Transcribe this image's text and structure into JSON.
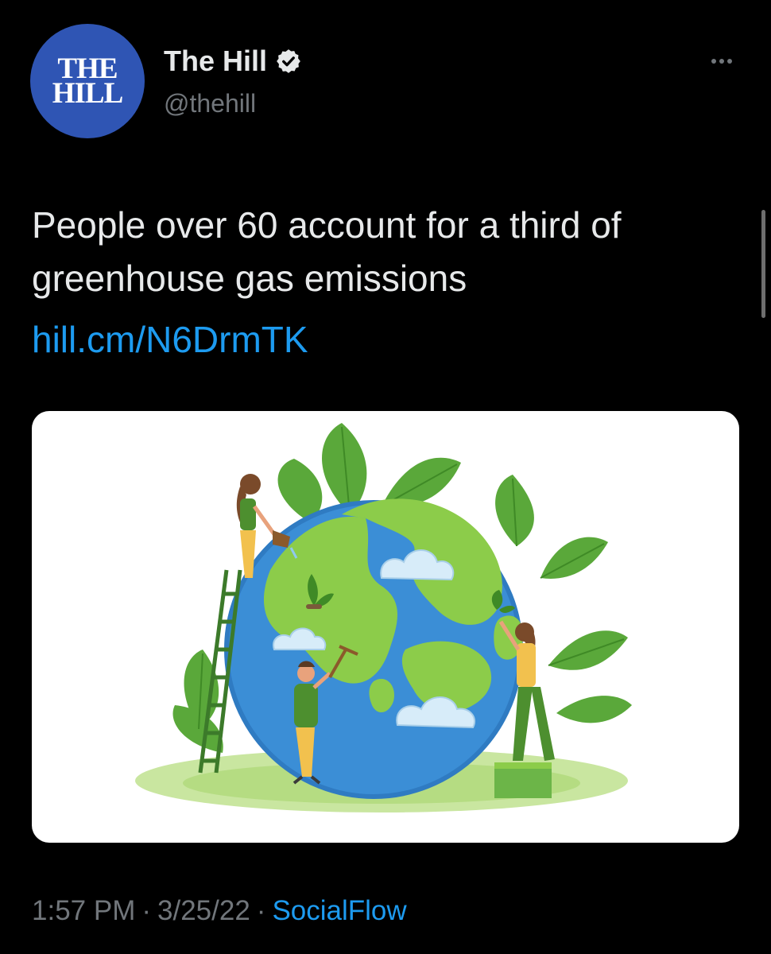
{
  "author": {
    "avatar_line1": "THE",
    "avatar_line2": "HILL",
    "display_name": "The Hill",
    "handle": "@thehill",
    "verified": true
  },
  "tweet": {
    "text": "People over 60 account for a third of greenhouse gas emissions",
    "link": "hill.cm/N6DrmTK"
  },
  "meta": {
    "time": "1:57 PM",
    "date": "3/25/22",
    "separator": "·",
    "source": "SocialFlow"
  },
  "colors": {
    "background": "#000000",
    "text": "#e7e9ea",
    "muted": "#71767b",
    "link": "#1d9bf0",
    "avatar": "#2f55b4",
    "verified_badge": "#e7e9ea"
  },
  "icons": {
    "verified": "verified-badge-icon",
    "more": "more-options-icon"
  }
}
